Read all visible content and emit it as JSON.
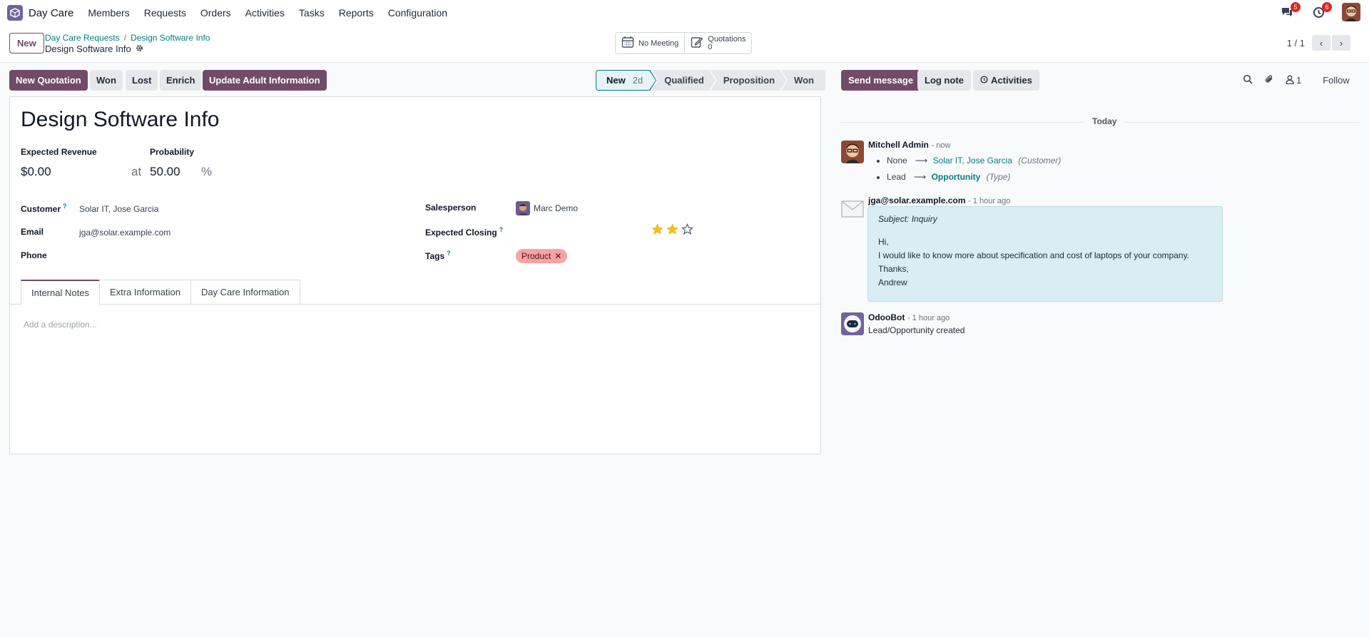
{
  "navbar": {
    "app_name": "Day Care",
    "menu": [
      "Members",
      "Requests",
      "Orders",
      "Activities",
      "Tasks",
      "Reports",
      "Configuration"
    ],
    "messages_badge": "5",
    "activities_badge": "6"
  },
  "control_panel": {
    "new_label": "New",
    "breadcrumb_parent": "Day Care Requests",
    "breadcrumb_sep": "/",
    "breadcrumb_current": "Design Software Info",
    "record_name": "Design Software Info",
    "meeting_label": "No Meeting",
    "quotations_label": "Quotations",
    "quotations_count": "0",
    "pager_value": "1 / 1"
  },
  "actions": {
    "new_quotation": "New Quotation",
    "won": "Won",
    "lost": "Lost",
    "enrich": "Enrich",
    "update_adult": "Update Adult Information"
  },
  "stages": {
    "new": "New",
    "new_days": "2d",
    "qualified": "Qualified",
    "proposition": "Proposition",
    "won": "Won"
  },
  "form": {
    "title": "Design Software Info",
    "expected_revenue_label": "Expected Revenue",
    "expected_revenue": "$0.00",
    "at": "at",
    "probability_label": "Probability",
    "probability": "50.00",
    "percent": "%",
    "customer_label": "Customer",
    "customer": "Solar IT, Jose Garcia",
    "email_label": "Email",
    "email": "jga@solar.example.com",
    "phone_label": "Phone",
    "salesperson_label": "Salesperson",
    "salesperson": "Marc Demo",
    "expected_closing_label": "Expected Closing",
    "tags_label": "Tags",
    "tag": "Product",
    "priority_stars": 2,
    "help_mark": "?",
    "tabs": [
      "Internal Notes",
      "Extra Information",
      "Day Care Information"
    ],
    "description_placeholder": "Add a description..."
  },
  "chatter": {
    "send_message": "Send message",
    "log_note": "Log note",
    "activities": "Activities",
    "followers_count": "1",
    "follow": "Follow",
    "today": "Today",
    "messages": [
      {
        "author": "Mitchell Admin",
        "time": "- now",
        "changes": [
          {
            "old": "None",
            "new": "Solar IT, Jose Garcia",
            "field": "(Customer)"
          },
          {
            "old": "Lead",
            "new": "Opportunity",
            "field": "(Type)"
          }
        ]
      },
      {
        "author": "jga@solar.example.com",
        "time": "- 1 hour ago",
        "subject": "Subject: Inquiry",
        "body": [
          "Hi,",
          "I would like to know more about specification and cost of laptops of your company.",
          "Thanks,",
          "Andrew"
        ]
      },
      {
        "author": "OdooBot",
        "time": "- 1 hour ago",
        "body": "Lead/Opportunity created"
      }
    ]
  },
  "colors": {
    "primary": "#714b67",
    "link": "#017e84",
    "tag": "#f8a3a3",
    "badge": "#dc2626"
  }
}
